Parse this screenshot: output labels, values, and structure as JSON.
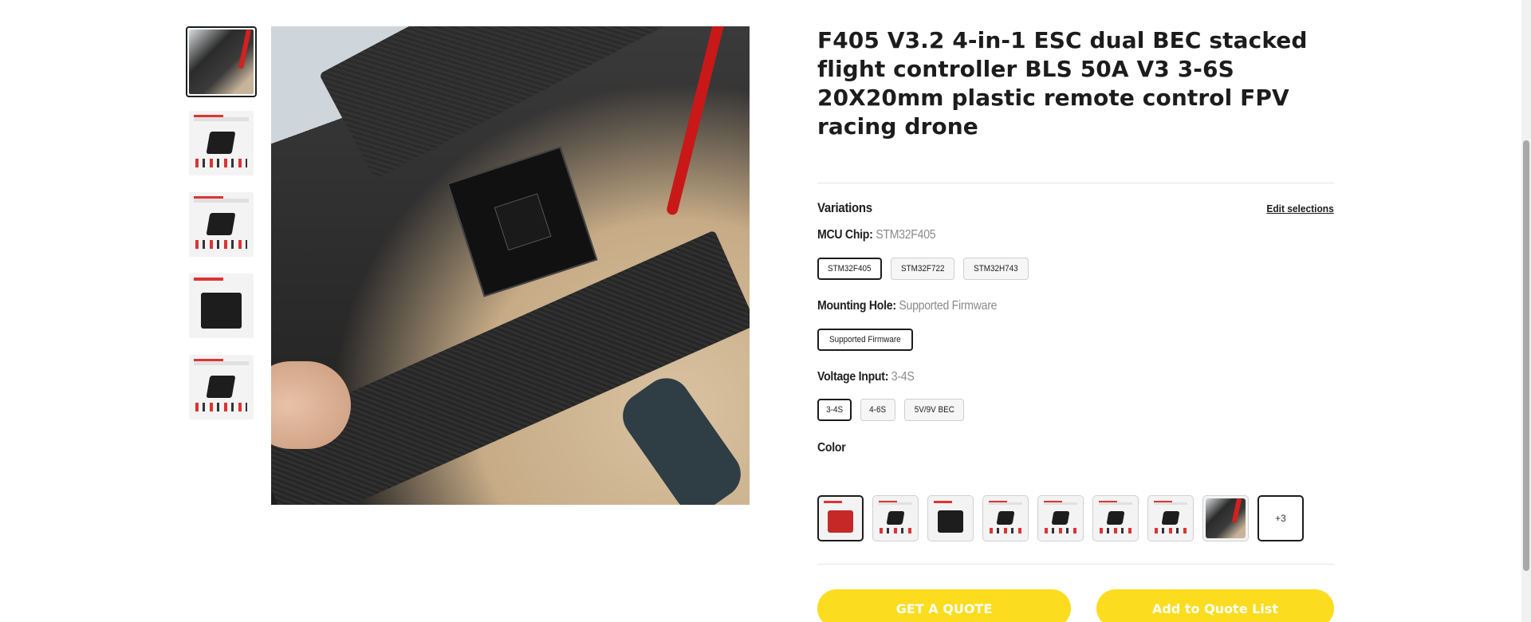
{
  "gallery": {
    "thumbnails": [
      {
        "name": "thumb-photo",
        "style": "photo"
      },
      {
        "name": "thumb-diagram-1",
        "style": "diag"
      },
      {
        "name": "thumb-diagram-2",
        "style": "diag"
      },
      {
        "name": "thumb-diagram-3",
        "style": "big"
      },
      {
        "name": "thumb-diagram-4",
        "style": "diag"
      }
    ],
    "active_index": 0
  },
  "product": {
    "title": "F405 V3.2 4-in-1 ESC dual BEC stacked flight controller BLS 50A V3 3-6S 20X20mm plastic remote control FPV racing drone"
  },
  "variations": {
    "title": "Variations",
    "edit_label": "Edit selections",
    "mcu": {
      "label": "MCU Chip:",
      "value": "STM32F405",
      "options": [
        "STM32F405",
        "STM32F722",
        "STM32H743"
      ],
      "selected": 0
    },
    "mounting": {
      "label": "Mounting Hole:",
      "value": "Supported Firmware",
      "options": [
        "Supported Firmware"
      ],
      "selected": 0
    },
    "voltage": {
      "label": "Voltage Input:",
      "value": "3-4S",
      "options": [
        "3-4S",
        "4-6S",
        "5V/9V BEC"
      ],
      "selected": 0
    },
    "color": {
      "label": "Color",
      "more_label": "+3",
      "swatch_count": 8,
      "selected": 0
    }
  },
  "actions": {
    "quote_label": "GET A QUOTE",
    "add_label": "Add to Quote List"
  },
  "colors": {
    "accent_yellow": "#fcdc1e",
    "text_dark": "#1c1c1c",
    "muted": "#8a8a8a"
  }
}
